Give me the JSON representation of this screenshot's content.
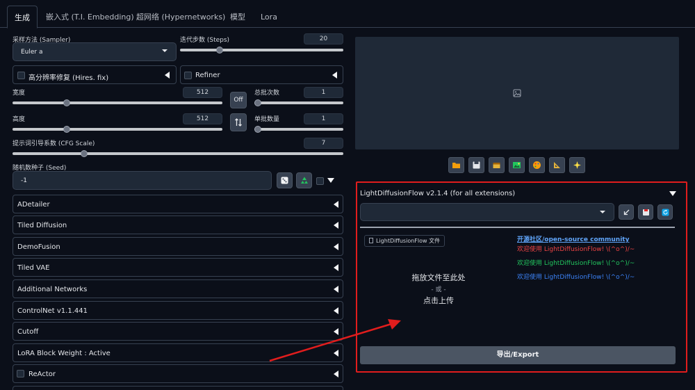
{
  "tabs": [
    "生成",
    "嵌入式 (T.I. Embedding)",
    "超网络 (Hypernetworks)",
    "模型",
    "Lora"
  ],
  "sampler": {
    "label": "采样方法 (Sampler)",
    "value": "Euler a"
  },
  "steps": {
    "label": "迭代步数 (Steps)",
    "value": "20"
  },
  "hires": {
    "label": "高分辨率修复 (Hires. fix)"
  },
  "refiner": {
    "label": "Refiner"
  },
  "width": {
    "label": "宽度",
    "value": "512"
  },
  "height": {
    "label": "高度",
    "value": "512"
  },
  "off_button": "Off",
  "batch_count": {
    "label": "总批次数",
    "value": "1"
  },
  "batch_size": {
    "label": "单批数量",
    "value": "1"
  },
  "cfg": {
    "label": "提示词引导系数 (CFG Scale)",
    "value": "7"
  },
  "seed": {
    "label": "随机数种子 (Seed)",
    "value": "-1"
  },
  "accordions": [
    "ADetailer",
    "Tiled Diffusion",
    "DemoFusion",
    "Tiled VAE",
    "Additional Networks",
    "ControlNet v1.1.441",
    "Cutoff",
    "LoRA Block Weight : Active"
  ],
  "reactor": {
    "label": "ReActor"
  },
  "ldf": {
    "title": "LightDiffusionFlow v2.1.4 (for all extensions)",
    "file_chip": "LightDiffusionFlow 文件",
    "upload": {
      "drop": "拖放文件至此处",
      "or": "- 或 -",
      "click": "点击上传"
    },
    "community_link": "开源社区/open-source community",
    "welcome_red": "欢迎使用 LightDiffusionFlow! \\(^o^)/~",
    "welcome_green": "欢迎使用 LightDiffusionFlow! \\(^o^)/~",
    "welcome_blue": "欢迎使用 LightDiffusionFlow! \\(^o^)/~",
    "export_button": "导出/Export"
  },
  "sliders": {
    "steps": 0.23,
    "width": 0.25,
    "height": 0.25,
    "batch_count": 0.0,
    "batch_size": 0.0,
    "cfg": 0.21
  },
  "colors": {
    "accent_red": "#e11d1d",
    "link_blue": "#60a5fa",
    "welcome_red": "#ef4444",
    "welcome_green": "#22c55e",
    "welcome_blue": "#3b82f6"
  }
}
